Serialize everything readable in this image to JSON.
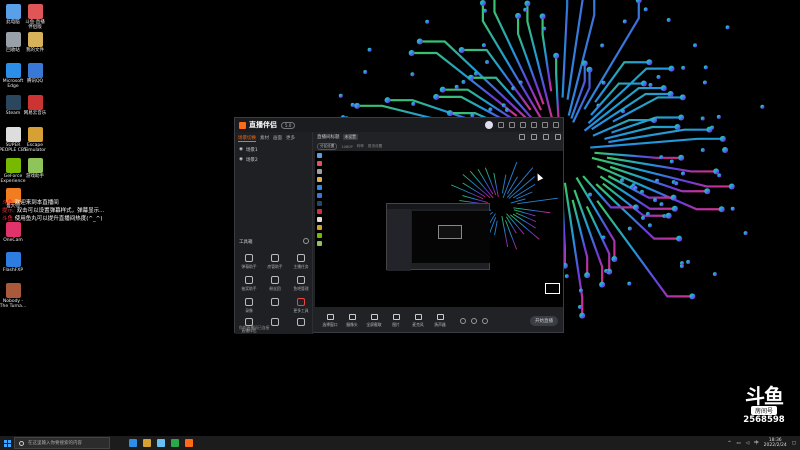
{
  "desktop": {
    "icons": [
      {
        "label": "此电脑",
        "color": "#5aa0e8"
      },
      {
        "label": "斗鱼·直播\n伴侣版",
        "color": "#e05555"
      },
      {
        "label": "回收站",
        "color": "#9aa0a8"
      },
      {
        "label": "我的文件",
        "color": "#d8b25a"
      },
      {
        "label": "Microsoft\nEdge",
        "color": "#2b8ee8"
      },
      {
        "label": "腾讯QQ",
        "color": "#3a78d6"
      },
      {
        "label": "Steam",
        "color": "#2a475e"
      },
      {
        "label": "网易云音乐",
        "color": "#c33"
      },
      {
        "label": "SUPER\nPEOPLE CBT",
        "color": "#ddd"
      },
      {
        "label": "Escape\nSimulator",
        "color": "#d6a034"
      },
      {
        "label": "GeForce\nExperience",
        "color": "#76b900"
      },
      {
        "label": "游戏助手",
        "color": "#8fc45a"
      },
      {
        "label": "鲁大师",
        "color": "#f27d20"
      },
      {
        "label": "OneCam",
        "color": "#e0336b"
      },
      {
        "label": "FlashFXP",
        "color": "#2d7de0"
      },
      {
        "label": "Nobody -\nThe Turna...",
        "color": "#a85a3a"
      }
    ]
  },
  "comments": [
    {
      "nick": "斗鱼",
      "text": "欢迎来到本直播间"
    },
    {
      "nick": "提示:",
      "text": "双击可以设置弹幕样式，弹幕显示..."
    },
    {
      "nick": "斗鱼",
      "text": "使用鱼丸可以提升直播间热度(^_^)"
    }
  ],
  "window": {
    "brand": "直播伴侣",
    "version": "5.0",
    "left_tabs": [
      "场景切换",
      "素材",
      "画面",
      "更多"
    ],
    "scenes": [
      "场景1",
      "场景2"
    ],
    "tools_title": "工具箱",
    "tools": [
      "弹幕助手",
      "房管助手",
      "主播任务",
      "抽奖助手",
      "粉丝团",
      "鱼吧管理",
      "录像",
      "",
      "更多工具",
      "直播伴侣",
      "",
      ""
    ],
    "status": "你的直播间已连接",
    "stream_title": "直播间标题",
    "stream_tag": "未设置",
    "sub_items": [
      "分区设置",
      "1080P",
      "码率",
      "推流设置"
    ],
    "controls": [
      "选择窗口",
      "摄像头",
      "全屏截取",
      "图片",
      "麦克风",
      "扬声器"
    ],
    "go_live": "开始直播"
  },
  "watermark": {
    "logo": "斗鱼",
    "room_label": "房间号",
    "room_number": "2568598"
  },
  "taskbar": {
    "search_placeholder": "在这里输入你要搜索的内容",
    "time": "18:36",
    "date": "2022/2/24",
    "apps": [
      {
        "name": "edge",
        "color": "#2b8ee8"
      },
      {
        "name": "game",
        "color": "#d6a034"
      },
      {
        "name": "steam",
        "color": "#66c0f4"
      },
      {
        "name": "monitor",
        "color": "#2ba84a"
      },
      {
        "name": "douyu",
        "color": "#ff6a16"
      }
    ]
  }
}
